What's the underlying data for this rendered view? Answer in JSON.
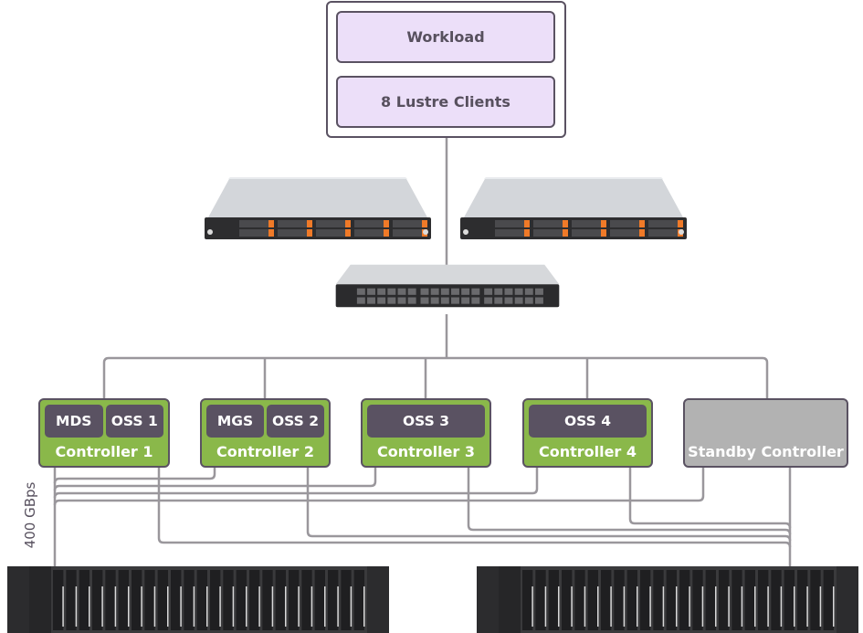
{
  "diagram": {
    "client_group": {
      "workload_label": "Workload",
      "clients_label": "8 Lustre Clients"
    },
    "servers": [
      {
        "type": "1U server",
        "drive_bays": 10,
        "accent_color": "#f07a28"
      },
      {
        "type": "1U server",
        "drive_bays": 10,
        "accent_color": "#f07a28"
      }
    ],
    "network_switch": {
      "type": "switch",
      "ports": 36
    },
    "controllers": [
      {
        "roles": [
          "MDS",
          "OSS 1"
        ],
        "label": "Controller 1",
        "state": "active",
        "color": "#8ab84a"
      },
      {
        "roles": [
          "MGS",
          "OSS 2"
        ],
        "label": "Controller 2",
        "state": "active",
        "color": "#8ab84a"
      },
      {
        "roles": [
          "OSS 3"
        ],
        "label": "Controller 3",
        "state": "active",
        "color": "#8ab84a"
      },
      {
        "roles": [
          "OSS 4"
        ],
        "label": "Controller 4",
        "state": "active",
        "color": "#8ab84a"
      },
      {
        "roles": [],
        "label": "Standby Controller",
        "state": "standby",
        "color": "#b2b2b2"
      }
    ],
    "link_label": "400 GBps",
    "storage_enclosures": [
      {
        "type": "2U storage enclosure",
        "drive_bays": 24
      },
      {
        "type": "2U storage enclosure",
        "drive_bays": 24
      }
    ],
    "colors": {
      "line": "#9a979c",
      "border": "#5a5262",
      "client_fill": "#ecdff9",
      "role_fill": "#5a5262",
      "text_dark": "#57505e"
    }
  }
}
